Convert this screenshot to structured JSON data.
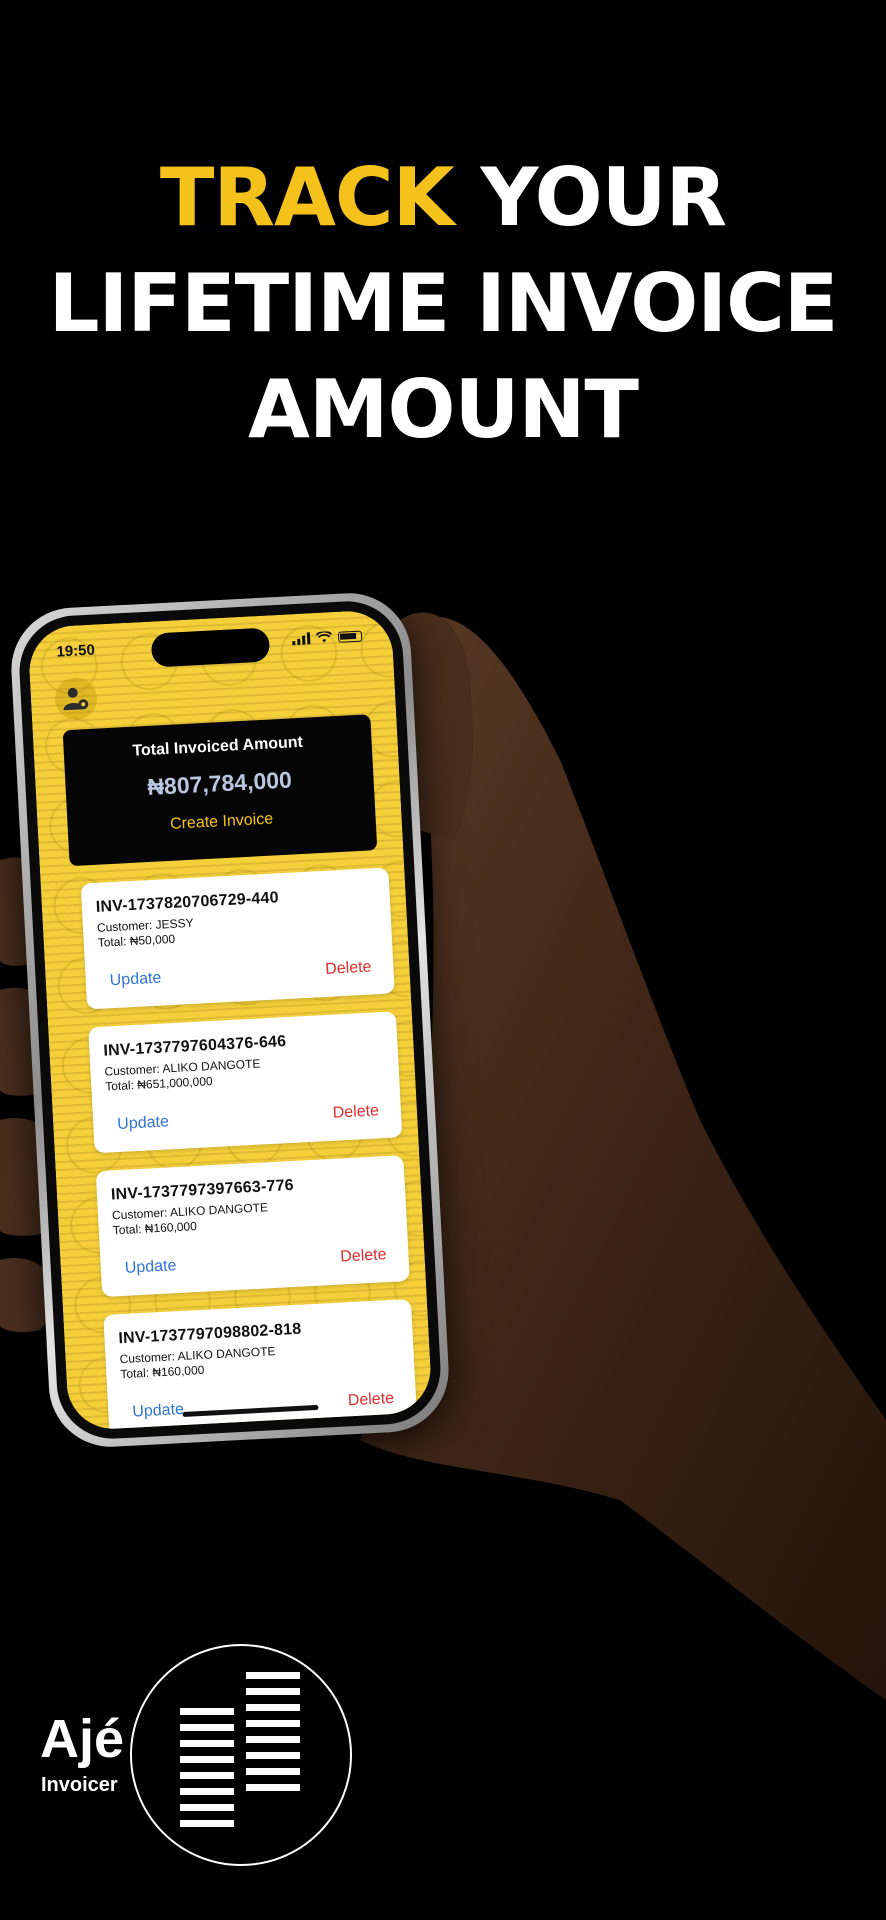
{
  "headline": {
    "accent": "TRACK",
    "line1_rest": " YOUR",
    "line2": "LIFETIME INVOICE",
    "line3": "AMOUNT"
  },
  "colors": {
    "accent": "#f5c21b",
    "screen_bg": "#f4cf3a",
    "update": "#2f74d8",
    "delete": "#e03131"
  },
  "phone": {
    "status_time": "19:50",
    "profile_icon": "user-settings-icon",
    "summary": {
      "title": "Total Invoiced Amount",
      "amount": "₦807,784,000",
      "create_label": "Create Invoice"
    },
    "invoices": [
      {
        "id": "INV-1737820706729-440",
        "customer": "Customer: JESSY",
        "total": "Total: ₦50,000",
        "update": "Update",
        "delete": "Delete"
      },
      {
        "id": "INV-1737797604376-646",
        "customer": "Customer: ALIKO DANGOTE",
        "total": "Total: ₦651,000,000",
        "update": "Update",
        "delete": "Delete"
      },
      {
        "id": "INV-1737797397663-776",
        "customer": "Customer: ALIKO DANGOTE",
        "total": "Total: ₦160,000",
        "update": "Update",
        "delete": "Delete"
      },
      {
        "id": "INV-1737797098802-818",
        "customer": "Customer: ALIKO DANGOTE",
        "total": "Total: ₦160,000",
        "update": "Update",
        "delete": "Delete"
      }
    ]
  },
  "logo": {
    "word": "Ajé",
    "sub": "Invoicer"
  }
}
